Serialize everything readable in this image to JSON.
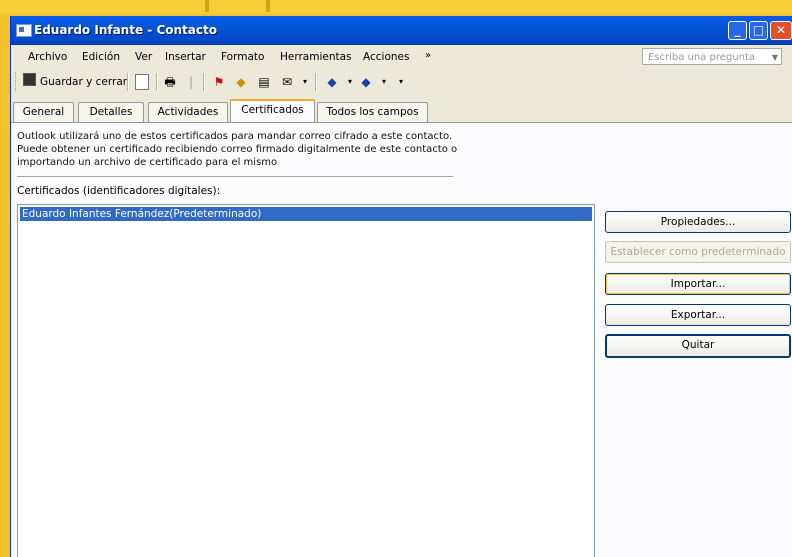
{
  "window": {
    "title": "Eduardo Infante - Contacto",
    "buttons": {
      "minimize": "_",
      "maximize": "□",
      "close": "✕"
    }
  },
  "menu": {
    "items": [
      "Archivo",
      "Edición",
      "Ver",
      "Insertar",
      "Formato",
      "Herramientas",
      "Acciones"
    ],
    "overflow": "»",
    "help_placeholder": "Escriba una pregunta"
  },
  "toolbar": {
    "save_close": "Guardar y cerrar",
    "icons": [
      "save-icon",
      "print-icon",
      "flag-icon",
      "categories-icon",
      "address-book-icon",
      "previous-icon",
      "next-icon"
    ]
  },
  "tabs": [
    {
      "label": "General",
      "active": false
    },
    {
      "label": "Detalles",
      "active": false
    },
    {
      "label": "Actividades",
      "active": false
    },
    {
      "label": "Certificados",
      "active": true
    },
    {
      "label": "Todos los campos",
      "active": false
    }
  ],
  "certificates": {
    "description": [
      "Outlook utilizará uno de estos certificados para mandar correo cifrado a este contacto.",
      "Puede obtener un certificado recibiendo correo firmado digitalmente de este contacto o",
      "importando un archivo de certificado para el mismo"
    ],
    "list_label": "Certificados (identificadores digitales):",
    "items": [
      "Eduardo Infantes Fernández(Predeterminado)"
    ],
    "buttons": {
      "properties": "Propiedades...",
      "set_default": "Establecer como predeterminado",
      "import": "Importar...",
      "export": "Exportar...",
      "remove": "Quitar"
    }
  },
  "colors": {
    "titlebar": "#0553d8",
    "selection": "#316ac5",
    "desktop": "#f4c22a",
    "active_tab_accent": "#f7a828"
  }
}
